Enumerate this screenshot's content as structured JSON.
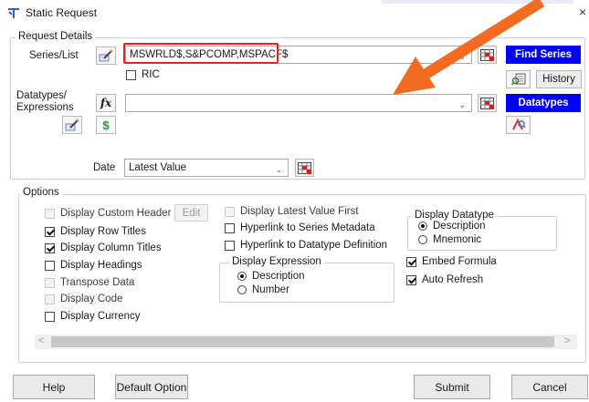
{
  "window": {
    "title": "Static Request",
    "close_glyph": "×"
  },
  "request_details": {
    "legend": "Request Details",
    "series_label": "Series/List",
    "series_value": "MSWRLD$,S&PCOMP,MSPACF$",
    "ric_label": "RIC",
    "find_series_button": "Find Series",
    "history_button": "History",
    "datatypes_label_line1": "Datatypes/",
    "datatypes_label_line2": "Expressions",
    "datatypes_value": "",
    "datatypes_button": "Datatypes",
    "fx_glyph": "fx",
    "currency_glyph": "$",
    "date_label": "Date",
    "date_value": "Latest Value"
  },
  "options": {
    "legend": "Options",
    "edit_button": "Edit",
    "col1": [
      {
        "label": "Display Custom Header",
        "checked": false,
        "disabled": true
      },
      {
        "label": "Display Row Titles",
        "checked": true,
        "disabled": false
      },
      {
        "label": "Display Column Titles",
        "checked": true,
        "disabled": false
      },
      {
        "label": "Display Headings",
        "checked": false,
        "disabled": false
      },
      {
        "label": "Transpose Data",
        "checked": false,
        "disabled": true
      },
      {
        "label": "Display Code",
        "checked": false,
        "disabled": true
      },
      {
        "label": "Display Currency",
        "checked": false,
        "disabled": false
      }
    ],
    "col2": [
      {
        "label": "Display Latest Value First",
        "checked": false,
        "disabled": true
      },
      {
        "label": "Hyperlink to Series Metadata",
        "checked": false,
        "disabled": false
      },
      {
        "label": "Hyperlink to Datatype Definition",
        "checked": false,
        "disabled": false
      }
    ],
    "display_expression": {
      "legend": "Display Expression",
      "opt1": "Description",
      "opt2": "Number",
      "selected": "Description"
    },
    "display_datatype": {
      "legend": "Display Datatype",
      "opt1": "Description",
      "opt2": "Mnemonic",
      "selected": "Description"
    },
    "embed_formula": {
      "label": "Embed Formula",
      "checked": true
    },
    "auto_refresh": {
      "label": "Auto Refresh",
      "checked": true
    }
  },
  "scroll": {
    "left_glyph": "<",
    "right_glyph": ">"
  },
  "buttons": {
    "help": "Help",
    "default_option": "Default Option",
    "submit": "Submit",
    "cancel": "Cancel"
  },
  "colors": {
    "accent_blue": "#0000ff",
    "highlight_red": "#e32222",
    "arrow_orange": "#f26b21"
  },
  "icons": {
    "title": "app-icon",
    "series_picker": "pencil-list-icon",
    "grid_picker": "red-grid-icon",
    "fx": "function-icon",
    "currency": "dollar-icon",
    "history": "history-search-icon",
    "datatype_search": "datatype-search-icon",
    "annotation": "orange-arrow-icon"
  }
}
